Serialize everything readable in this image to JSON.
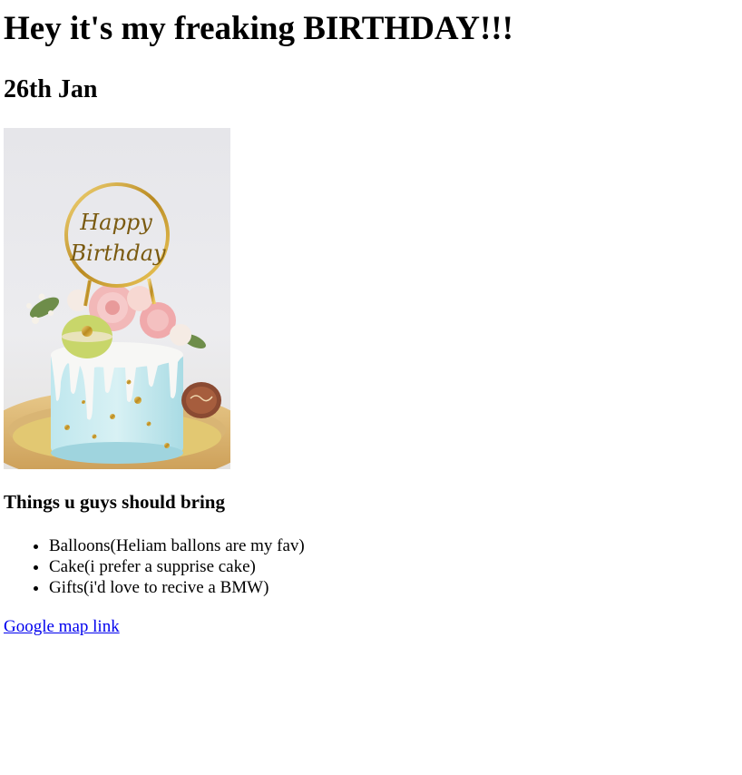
{
  "heading": "Hey it's my freaking BIRTHDAY!!!",
  "date": "26th Jan",
  "image": {
    "alt": "Happy Birthday cake",
    "topper_text_line1": "Happy",
    "topper_text_line2": "Birthday"
  },
  "bring_heading": "Things u guys should bring",
  "bring_items": [
    "Balloons(Heliam ballons are my fav)",
    "Cake(i prefer a supprise cake)",
    "Gifts(i'd love to recive a BMW)"
  ],
  "map_link_text": "Google map link",
  "colors": {
    "link": "#0000ee",
    "text": "#000000"
  }
}
